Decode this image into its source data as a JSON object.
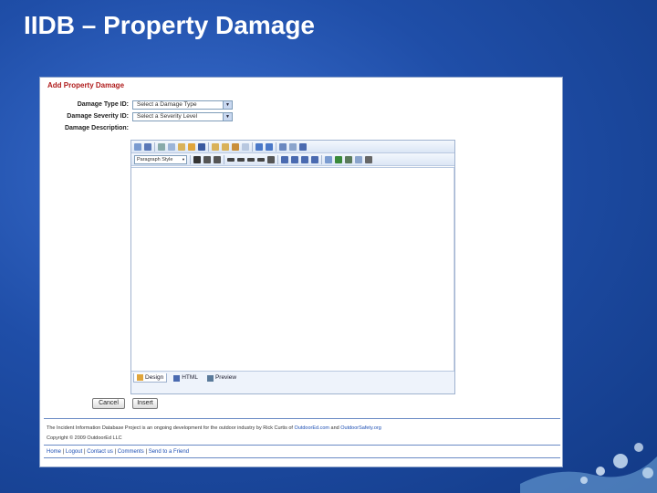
{
  "slide": {
    "title": "IIDB – Property Damage"
  },
  "form": {
    "title": "Add Property Damage",
    "damage_type_label": "Damage Type ID:",
    "damage_type_value": "Select a Damage Type",
    "damage_severity_label": "Damage Severity ID:",
    "damage_severity_value": "Select a Severity Level",
    "damage_description_label": "Damage Description:"
  },
  "editor": {
    "paragraph_style": "Paragraph Style",
    "modes": [
      "Design",
      "HTML",
      "Preview"
    ]
  },
  "buttons": {
    "cancel": "Cancel",
    "insert": "Insert"
  },
  "footer": {
    "note_prefix": "The Incident Information Database Project is an ongoing development for the outdoor industry by Rick Curtis of ",
    "link1": "OutdoorEd.com",
    "note_mid": " and ",
    "link2": "OutdoorSafety.org",
    "copyright": "Copyright © 2009 OutdoorEd LLC",
    "nav": [
      "Home",
      "Logout",
      "Contact us",
      "Comments",
      "Send to a Friend"
    ]
  },
  "colors": {
    "slide_background": "#1f4ea8",
    "form_title": "#b01c1c",
    "link": "#1d4fb4"
  }
}
